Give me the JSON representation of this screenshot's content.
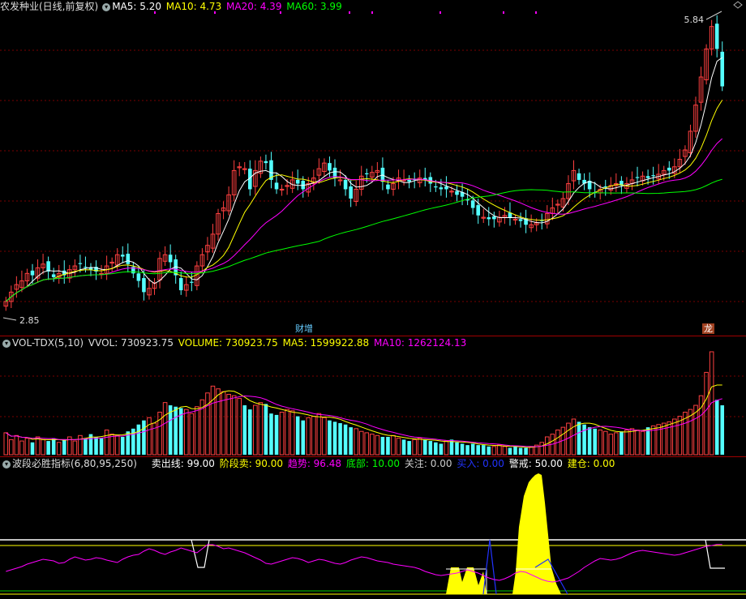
{
  "main_header": {
    "title": "农发种业(日线,前复权)",
    "ma5": "MA5: 5.20",
    "ma10": "MA10: 4.73",
    "ma20": "MA20: 4.39",
    "ma60": "MA60: 3.99"
  },
  "vol_header": {
    "name": "VOL-TDX(5,10)",
    "vvol": "VVOL: 730923.75",
    "volume": "VOLUME: 730923.75",
    "ma5": "MA5: 1599922.88",
    "ma10": "MA10: 1262124.13"
  },
  "ind_header": {
    "name": "波段必胜指标(6,80,95,250)",
    "items": [
      {
        "label": "卖出线: 99.00",
        "color": "#ffffff"
      },
      {
        "label": "阶段卖: 90.00",
        "color": "#ffff00"
      },
      {
        "label": "趋势: 96.48",
        "color": "#ff00ff"
      },
      {
        "label": "底部: 10.00",
        "color": "#00ff00"
      },
      {
        "label": "关注: 0.00",
        "color": "#cccccc"
      },
      {
        "label": "买入: 0.00",
        "color": "#0000ff"
      },
      {
        "label": "警戒: 50.00",
        "color": "#ffffff"
      },
      {
        "label": "建仓: 0.00",
        "color": "#ffff00"
      }
    ]
  },
  "badges": {
    "caizeng": "财增",
    "long": "龙"
  },
  "chart_data": [
    {
      "type": "candlestick",
      "title": "农发种业(日线,前复权)",
      "price_high_label": "5.84",
      "price_low_label": "2.85",
      "ylim": [
        2.7,
        5.95
      ],
      "closes": [
        2.9,
        3.0,
        3.08,
        3.12,
        3.2,
        3.18,
        3.26,
        3.3,
        3.22,
        3.16,
        3.2,
        3.18,
        3.24,
        3.28,
        3.3,
        3.26,
        3.24,
        3.22,
        3.2,
        3.28,
        3.32,
        3.4,
        3.38,
        3.3,
        3.2,
        3.12,
        3.0,
        3.04,
        3.1,
        3.36,
        3.4,
        3.32,
        3.18,
        3.02,
        3.08,
        3.1,
        3.28,
        3.4,
        3.5,
        3.62,
        3.84,
        3.9,
        4.04,
        4.3,
        4.34,
        4.32,
        4.1,
        4.3,
        4.4,
        4.38,
        4.2,
        4.1,
        4.1,
        4.14,
        4.2,
        4.16,
        4.1,
        4.16,
        4.22,
        4.32,
        4.38,
        4.3,
        4.22,
        4.2,
        4.1,
        4.0,
        4.1,
        4.24,
        4.26,
        4.28,
        4.3,
        4.18,
        4.1,
        4.16,
        4.22,
        4.2,
        4.18,
        4.2,
        4.22,
        4.2,
        4.16,
        4.12,
        4.1,
        4.1,
        4.08,
        4.04,
        4.02,
        3.98,
        3.9,
        3.82,
        3.8,
        3.78,
        3.78,
        3.8,
        3.82,
        3.8,
        3.78,
        3.76,
        3.72,
        3.72,
        3.74,
        3.76,
        3.84,
        3.9,
        3.94,
        4.0,
        4.16,
        4.3,
        4.2,
        4.16,
        4.1,
        4.06,
        4.1,
        4.12,
        4.14,
        4.16,
        4.14,
        4.16,
        4.2,
        4.22,
        4.24,
        4.22,
        4.24,
        4.26,
        4.3,
        4.3,
        4.34,
        4.42,
        4.52,
        4.72,
        5.0,
        5.3,
        5.6,
        5.84,
        5.6,
        5.2
      ],
      "ma_lines": [
        {
          "name": "MA5",
          "value": 5.2,
          "color": "#ffffff"
        },
        {
          "name": "MA10",
          "value": 4.73,
          "color": "#ffff00"
        },
        {
          "name": "MA20",
          "value": 4.39,
          "color": "#ff00ff"
        },
        {
          "name": "MA60",
          "value": 3.99,
          "color": "#00ff00"
        }
      ]
    },
    {
      "type": "bar",
      "title": "VOL-TDX(5,10)",
      "volume_relative": [
        32,
        22,
        28,
        20,
        24,
        18,
        26,
        22,
        20,
        24,
        18,
        22,
        26,
        20,
        28,
        24,
        30,
        26,
        24,
        36,
        30,
        28,
        26,
        34,
        38,
        44,
        50,
        54,
        46,
        62,
        76,
        72,
        70,
        68,
        66,
        60,
        70,
        80,
        90,
        100,
        96,
        92,
        88,
        86,
        82,
        72,
        66,
        72,
        76,
        74,
        60,
        58,
        62,
        66,
        64,
        56,
        50,
        54,
        56,
        60,
        54,
        50,
        48,
        46,
        44,
        40,
        38,
        34,
        32,
        30,
        28,
        26,
        26,
        28,
        24,
        22,
        20,
        22,
        24,
        22,
        20,
        18,
        16,
        20,
        22,
        18,
        16,
        14,
        16,
        14,
        14,
        12,
        12,
        14,
        12,
        10,
        12,
        10,
        10,
        12,
        14,
        18,
        26,
        30,
        36,
        40,
        46,
        52,
        48,
        44,
        40,
        38,
        36,
        34,
        30,
        32,
        34,
        36,
        38,
        36,
        34,
        40,
        42,
        44,
        46,
        48,
        52,
        56,
        62,
        66,
        72,
        86,
        120,
        150,
        80,
        72
      ],
      "series": [
        {
          "name": "VVOL",
          "last": 730923.75
        },
        {
          "name": "VOLUME",
          "last": 730923.75
        },
        {
          "name": "MA5",
          "last": 1599922.88
        },
        {
          "name": "MA10",
          "last": 1262124.13
        }
      ]
    },
    {
      "type": "line",
      "title": "波段必胜指标(6,80,95,250)",
      "ylim": [
        0,
        100
      ],
      "levels": [
        {
          "name": "卖出线",
          "value": 99.0,
          "color": "#ffffff"
        },
        {
          "name": "阶段卖",
          "value": 90.0,
          "color": "#ffff00"
        },
        {
          "name": "警戒",
          "value": 50.0,
          "color": "#ffffff"
        },
        {
          "name": "底部",
          "value": 10.0,
          "color": "#00ff00"
        }
      ],
      "trend": [
        30,
        34,
        38,
        42,
        48,
        52,
        56,
        60,
        58,
        56,
        50,
        52,
        60,
        66,
        62,
        58,
        60,
        64,
        62,
        58,
        55,
        52,
        60,
        66,
        70,
        72,
        80,
        86,
        82,
        76,
        72,
        78,
        82,
        88,
        84,
        80,
        76,
        86,
        96,
        96,
        92,
        86,
        88,
        84,
        80,
        76,
        70,
        64,
        58,
        50,
        48,
        52,
        56,
        60,
        64,
        62,
        58,
        52,
        56,
        60,
        58,
        54,
        50,
        48,
        52,
        58,
        62,
        66,
        64,
        60,
        56,
        54,
        52,
        48,
        46,
        44,
        42,
        40,
        36,
        30,
        26,
        22,
        20,
        22,
        24,
        26,
        30,
        34,
        30,
        26,
        20,
        14,
        10,
        8,
        12,
        18,
        26,
        30,
        28,
        22,
        16,
        10,
        6,
        4,
        6,
        10,
        14,
        22,
        30,
        40,
        48,
        56,
        62,
        60,
        58,
        60,
        64,
        70,
        76,
        80,
        82,
        80,
        78,
        76,
        74,
        72,
        70,
        72,
        76,
        80,
        84,
        88,
        92,
        94,
        96.48,
        96.48
      ],
      "trend_name": "趋势",
      "trend_last": 96.48
    }
  ]
}
